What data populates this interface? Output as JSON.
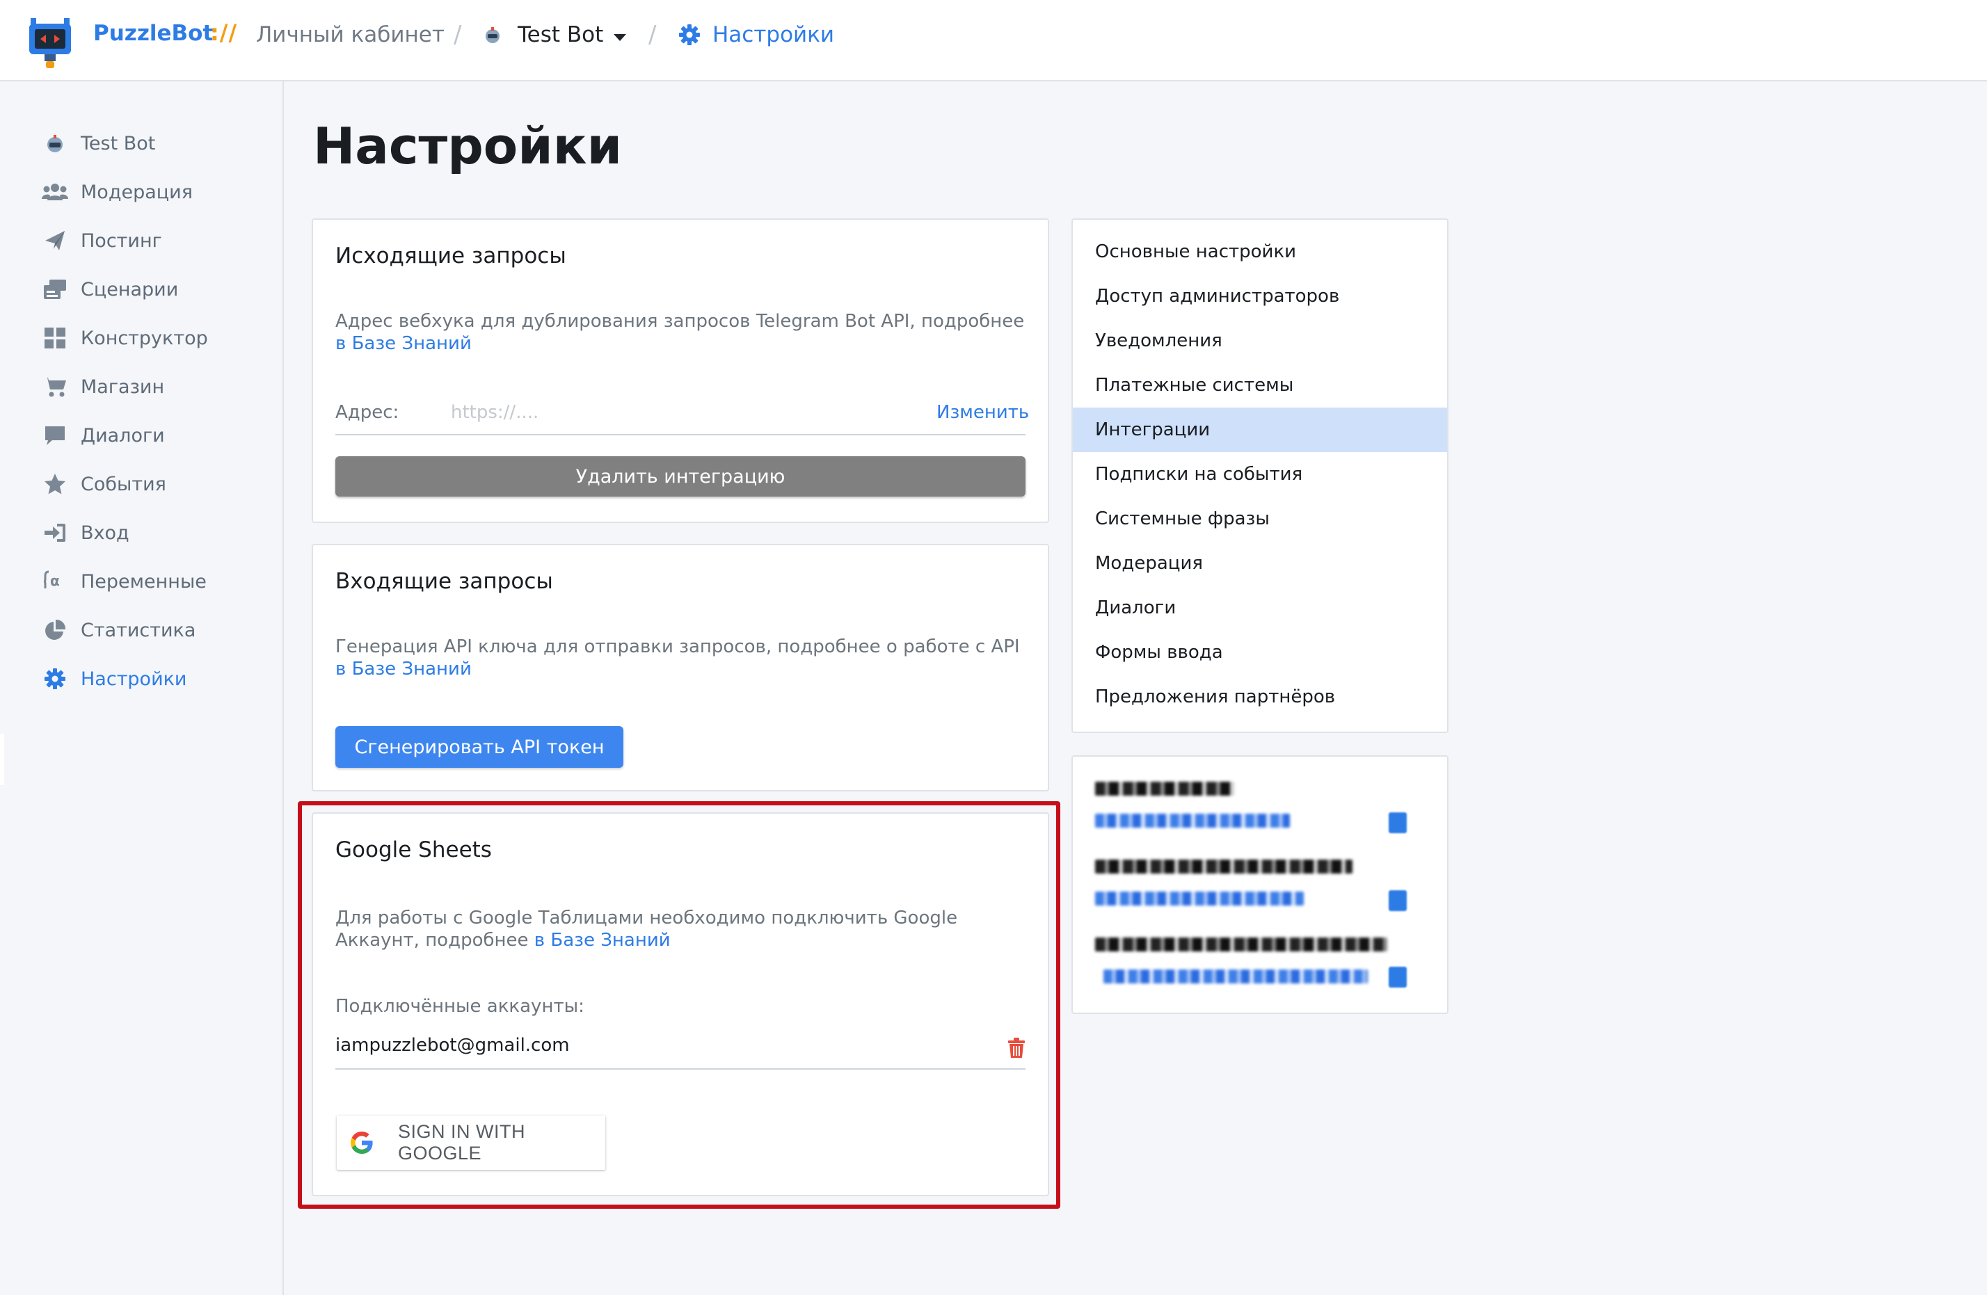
{
  "topbar": {
    "brand": "PuzzleBot",
    "brand_separator": "://",
    "crumb_cabinet": "Личный кабинет",
    "crumb_bot": "Test Bot",
    "crumb_settings": "Настройки"
  },
  "sidebar": {
    "items": [
      {
        "label": "Test Bot",
        "icon": "bot-icon"
      },
      {
        "label": "Модерация",
        "icon": "users-icon"
      },
      {
        "label": "Постинг",
        "icon": "paper-plane-icon"
      },
      {
        "label": "Сценарии",
        "icon": "scenario-icon"
      },
      {
        "label": "Конструктор",
        "icon": "grid-icon"
      },
      {
        "label": "Магазин",
        "icon": "cart-icon"
      },
      {
        "label": "Диалоги",
        "icon": "chat-icon"
      },
      {
        "label": "События",
        "icon": "star-icon"
      },
      {
        "label": "Вход",
        "icon": "sign-in-icon"
      },
      {
        "label": "Переменные",
        "icon": "variable-icon"
      },
      {
        "label": "Статистика",
        "icon": "pie-chart-icon"
      },
      {
        "label": "Настройки",
        "icon": "gear-icon",
        "active": true
      }
    ]
  },
  "page": {
    "title": "Настройки"
  },
  "outgoing": {
    "title": "Исходящие запросы",
    "desc": "Адрес вебхука для дублирования запросов Telegram Bot API, подробнее ",
    "desc_link": "в Базе Знаний",
    "address_label": "Адрес:",
    "address_placeholder": "https://....",
    "change_link": "Изменить",
    "delete_button": "Удалить интеграцию"
  },
  "incoming": {
    "title": "Входящие запросы",
    "desc": "Генерация API ключа для отправки запросов, подробнее о работе с API ",
    "desc_link": "в Базе Знаний",
    "generate_button": "Сгенерировать API токен"
  },
  "gsheets": {
    "title": "Google Sheets",
    "desc": "Для работы с Google Таблицами необходимо подключить Google Аккаунт, подробнее ",
    "desc_link": "в Базе Знаний",
    "accounts_label": "Подключённые аккаунты:",
    "account_email": "iampuzzlebot@gmail.com",
    "signin_button": "SIGN IN WITH GOOGLE"
  },
  "settings_menu": {
    "items": [
      {
        "label": "Основные настройки"
      },
      {
        "label": "Доступ администраторов"
      },
      {
        "label": "Уведомления"
      },
      {
        "label": "Платежные системы"
      },
      {
        "label": "Интеграции",
        "active": true
      },
      {
        "label": "Подписки на события"
      },
      {
        "label": "Системные фразы"
      },
      {
        "label": "Модерация"
      },
      {
        "label": "Диалоги"
      },
      {
        "label": "Формы ввода"
      },
      {
        "label": "Предложения партнёров"
      }
    ]
  },
  "colors": {
    "accent": "#2d7ce6",
    "highlight_border": "#c40f1a",
    "active_menu_bg": "#cfe0fb",
    "delete_icon": "#e74c3c"
  }
}
